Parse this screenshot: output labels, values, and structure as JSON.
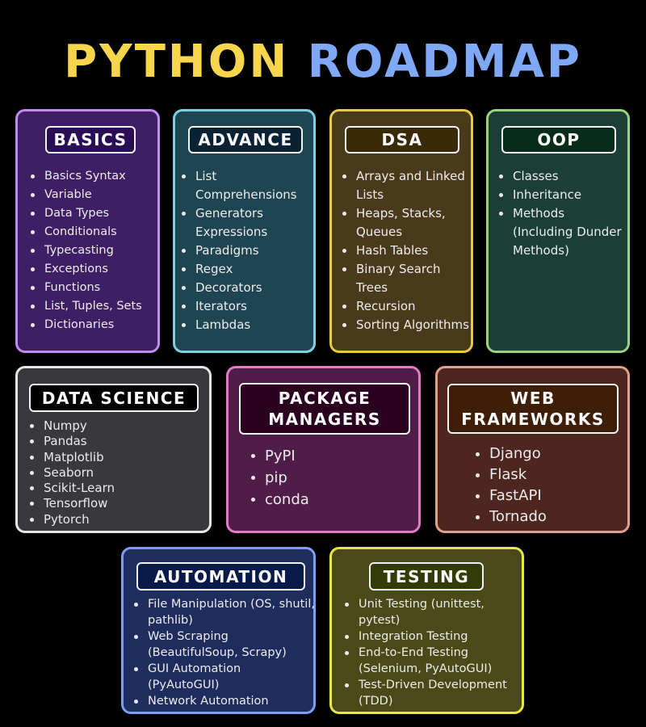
{
  "title": {
    "part1": "PYTHON",
    "part2": "ROADMAP"
  },
  "colors": {
    "title_part1": "#f7d64e",
    "title_part2": "#7fa9f6",
    "background": "#000000"
  },
  "sections": {
    "basics": {
      "header": "BASICS",
      "items": [
        "Basics Syntax",
        "Variable",
        "Data Types",
        "Conditionals",
        "Typecasting",
        "Exceptions",
        "Functions",
        "List, Tuples, Sets",
        "Dictionaries"
      ]
    },
    "advance": {
      "header": "ADVANCE",
      "items": [
        "List Comprehensions",
        "Generators Expressions",
        "Paradigms",
        "Regex",
        "Decorators",
        "Iterators",
        "Lambdas"
      ]
    },
    "dsa": {
      "header": "DSA",
      "items": [
        "Arrays and Linked Lists",
        "Heaps, Stacks, Queues",
        "Hash Tables",
        "Binary Search Trees",
        "Recursion",
        "Sorting Algorithms"
      ]
    },
    "oop": {
      "header": "OOP",
      "items": [
        "Classes",
        "Inheritance",
        "Methods (Including Dunder Methods)"
      ]
    },
    "data_science": {
      "header": "DATA SCIENCE",
      "items": [
        "Numpy",
        "Pandas",
        "Matplotlib",
        "Seaborn",
        "Scikit-Learn",
        "Tensorflow",
        "Pytorch"
      ]
    },
    "package_managers": {
      "header": "PACKAGE MANAGERS",
      "items": [
        "PyPI",
        "pip",
        "conda"
      ]
    },
    "web_frameworks": {
      "header": "WEB FRAMEWORKS",
      "items": [
        "Django",
        "Flask",
        "FastAPI",
        "Tornado"
      ]
    },
    "automation": {
      "header": "AUTOMATION",
      "items": [
        "File Manipulation (OS, shutil, pathlib)",
        "Web Scraping (BeautifulSoup, Scrapy)",
        "GUI Automation (PyAutoGUI)",
        "Network Automation"
      ]
    },
    "testing": {
      "header": "TESTING",
      "items": [
        "Unit Testing (unittest, pytest)",
        "Integration Testing",
        "End-to-End Testing (Selenium, PyAutoGUI)",
        "Test-Driven Development (TDD)"
      ]
    }
  }
}
